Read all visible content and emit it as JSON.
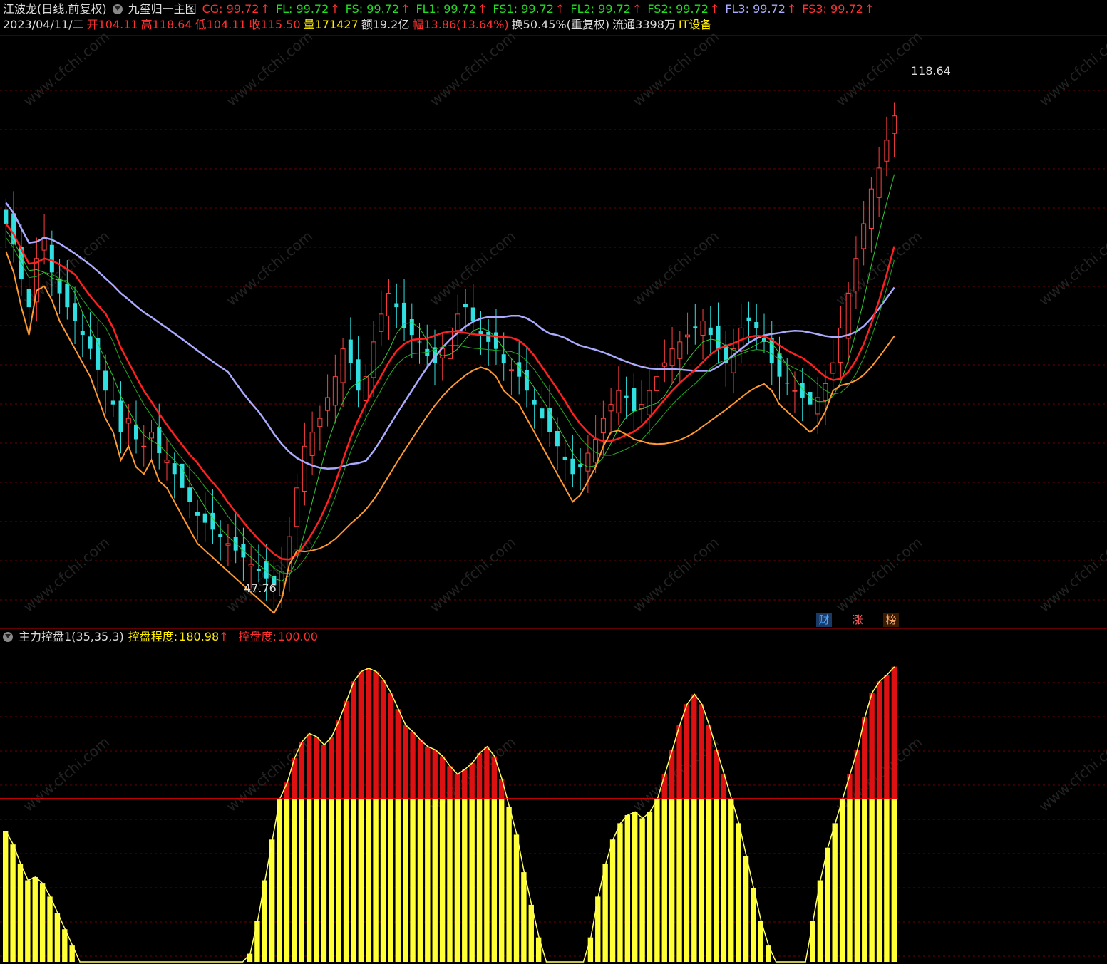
{
  "header": {
    "stock_name": "江波龙(日线,前复权)",
    "main_indicator": "九玺归一主图",
    "indicators": [
      {
        "label": "CG",
        "value": "99.72",
        "color": "#ff3030"
      },
      {
        "label": "FL",
        "value": "99.72",
        "color": "#22dd22"
      },
      {
        "label": "FS",
        "value": "99.72",
        "color": "#22dd22"
      },
      {
        "label": "FL1",
        "value": "99.72",
        "color": "#22dd22"
      },
      {
        "label": "FS1",
        "value": "99.72",
        "color": "#22dd22"
      },
      {
        "label": "FL2",
        "value": "99.72",
        "color": "#22dd22"
      },
      {
        "label": "FS2",
        "value": "99.72",
        "color": "#22dd22"
      },
      {
        "label": "FL3",
        "value": "99.72",
        "color": "#aaaaff"
      },
      {
        "label": "FS3",
        "value": "99.72",
        "color": "#ff3030"
      }
    ],
    "up_arrow": "↑"
  },
  "quote": {
    "date": "2023/04/11/二",
    "open": "开104.11",
    "high": "高118.64",
    "low": "低104.11",
    "close": "收115.50",
    "volume": "量171427",
    "amount": "额19.2亿",
    "change": "幅13.86(13.64%)",
    "turnover": "换50.45%(重复权)",
    "float": "流通3398万",
    "sector": "IT设备"
  },
  "sub_panel": {
    "title": "主力控盘1(35,35,3)",
    "label1": "控盘程度",
    "value1": "180.98",
    "label2": "控盘度",
    "value2": "100.00"
  },
  "badges": [
    {
      "text": "财",
      "color": "#4da6ff",
      "bg": "#1a3a66"
    },
    {
      "text": "涨",
      "color": "#ff6060",
      "bg": "#000000"
    },
    {
      "text": "榜",
      "color": "#ffaa66",
      "bg": "#3a1a00"
    }
  ],
  "watermark": "www.cfchi.com",
  "chart_data": [
    {
      "type": "candlestick",
      "price_max_label": "118.64",
      "price_min_label": "47.76",
      "ylim": [
        42,
        125
      ],
      "close_series": [
        100,
        97,
        92,
        88,
        95,
        98,
        93,
        90,
        88,
        86,
        84,
        82,
        79,
        76,
        74,
        70,
        72,
        69,
        68,
        70,
        67,
        66,
        64,
        62,
        60,
        58,
        57,
        56,
        55,
        54,
        53,
        52,
        51,
        50,
        49,
        48,
        50,
        55,
        62,
        68,
        70,
        72,
        75,
        78,
        82,
        80,
        76,
        78,
        83,
        87,
        90,
        88,
        85,
        84,
        83,
        81,
        80,
        82,
        85,
        87,
        88,
        86,
        84,
        83,
        82,
        80,
        79,
        78,
        76,
        74,
        72,
        70,
        68,
        66,
        64,
        65,
        67,
        69,
        72,
        74,
        76,
        75,
        73,
        74,
        76,
        78,
        80,
        82,
        83,
        84,
        85,
        86,
        84,
        82,
        80,
        82,
        85,
        86,
        85,
        83,
        80,
        78,
        77,
        76,
        75,
        74,
        75,
        77,
        80,
        85,
        90,
        95,
        100,
        105,
        108,
        112,
        115.5
      ],
      "s_labels_count": 6,
      "b_labels_count": 6
    },
    {
      "type": "bar",
      "name": "控盘程度",
      "threshold": 100,
      "ylim": [
        0,
        190
      ],
      "values": [
        80,
        72,
        60,
        50,
        52,
        48,
        40,
        30,
        20,
        10,
        0,
        0,
        0,
        0,
        0,
        0,
        0,
        0,
        0,
        0,
        0,
        0,
        0,
        0,
        0,
        0,
        0,
        0,
        0,
        0,
        0,
        0,
        0,
        5,
        25,
        50,
        75,
        100,
        110,
        125,
        135,
        140,
        138,
        133,
        138,
        148,
        160,
        172,
        178,
        180,
        178,
        173,
        165,
        155,
        145,
        141,
        136,
        132,
        130,
        126,
        120,
        115,
        118,
        122,
        128,
        132,
        126,
        112,
        95,
        78,
        55,
        35,
        15,
        0,
        0,
        0,
        0,
        0,
        0,
        15,
        40,
        60,
        75,
        85,
        90,
        92,
        88,
        92,
        100,
        115,
        130,
        145,
        158,
        164,
        158,
        145,
        130,
        115,
        100,
        85,
        65,
        45,
        25,
        10,
        0,
        0,
        0,
        0,
        0,
        25,
        50,
        70,
        85,
        100,
        115,
        130,
        150,
        165,
        172,
        176,
        180.98
      ]
    }
  ]
}
